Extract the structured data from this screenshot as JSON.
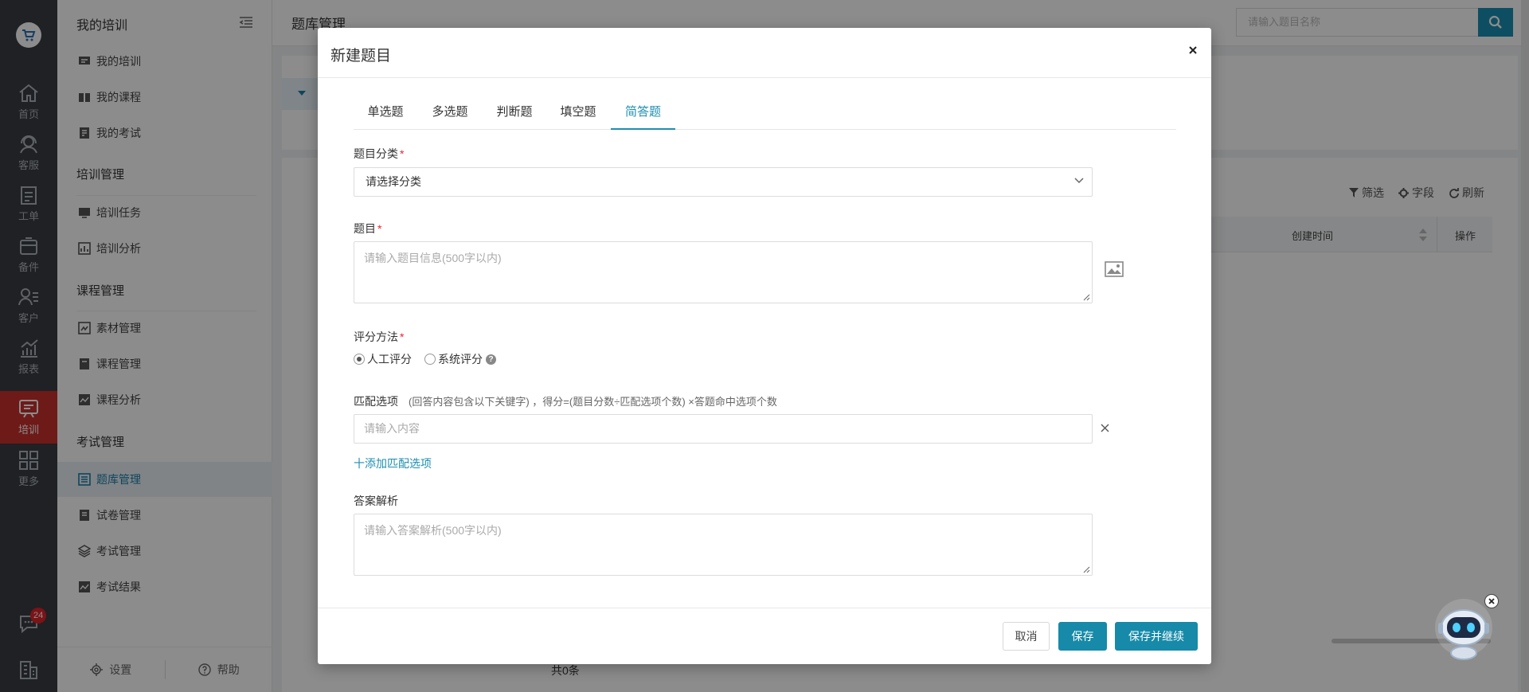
{
  "rail": {
    "items": [
      {
        "label": "首页",
        "icon": "home-icon"
      },
      {
        "label": "客服",
        "icon": "headset-icon"
      },
      {
        "label": "工单",
        "icon": "clipboard-icon"
      },
      {
        "label": "备件",
        "icon": "box-icon"
      },
      {
        "label": "客户",
        "icon": "user-list-icon"
      },
      {
        "label": "报表",
        "icon": "chart-icon"
      },
      {
        "label": "培训",
        "icon": "chat-board-icon"
      },
      {
        "label": "更多",
        "icon": "grid-icon"
      }
    ],
    "active_label": "培训",
    "chat_badge": "24"
  },
  "nav": {
    "header": "我的培训",
    "groups": [
      {
        "title": "培训管理"
      },
      {
        "title": "课程管理"
      },
      {
        "title": "考试管理"
      }
    ],
    "items": {
      "my_training": "我的培训",
      "my_courses": "我的课程",
      "my_exams": "我的考试",
      "training_tasks": "培训任务",
      "training_analysis": "培训分析",
      "material_mgmt": "素材管理",
      "course_mgmt": "课程管理",
      "course_analysis": "课程分析",
      "question_bank": "题库管理",
      "paper_mgmt": "试卷管理",
      "exam_mgmt": "考试管理",
      "exam_results": "考试结果"
    },
    "footer": {
      "settings": "设置",
      "help": "帮助"
    }
  },
  "main": {
    "page_title": "题库管理",
    "search_placeholder": "请输入题目名称",
    "tools": {
      "filter": "筛选",
      "fields": "字段",
      "refresh": "刷新"
    },
    "table_headers": {
      "created": "创建时间",
      "actions": "操作"
    },
    "total": "共0条"
  },
  "modal": {
    "title": "新建题目",
    "tabs": [
      "单选题",
      "多选题",
      "判断题",
      "填空题",
      "简答题"
    ],
    "active_tab": "简答题",
    "category_label": "题目分类",
    "category_value": "请选择分类",
    "question_label": "题目",
    "question_placeholder": "请输入题目信息(500字以内)",
    "scoring_label": "评分方法",
    "scoring_options": [
      "人工评分",
      "系统评分"
    ],
    "scoring_selected": "人工评分",
    "match_label": "匹配选项",
    "match_hint": "(回答内容包含以下关键字) ，得分=(题目分数÷匹配选项个数) ×答题命中选项个数",
    "match_placeholder": "请输入内容",
    "add_match": "十添加匹配选项",
    "analysis_label": "答案解析",
    "analysis_placeholder": "请输入答案解析(500字以内)",
    "buttons": {
      "cancel": "取消",
      "save": "保存",
      "save_continue": "保存并继续"
    },
    "required_mark": "*"
  },
  "colors": {
    "accent": "#1d8fb1",
    "rail_bg": "#3a3d42",
    "rail_active": "#c9302c",
    "required": "#ee2233"
  }
}
